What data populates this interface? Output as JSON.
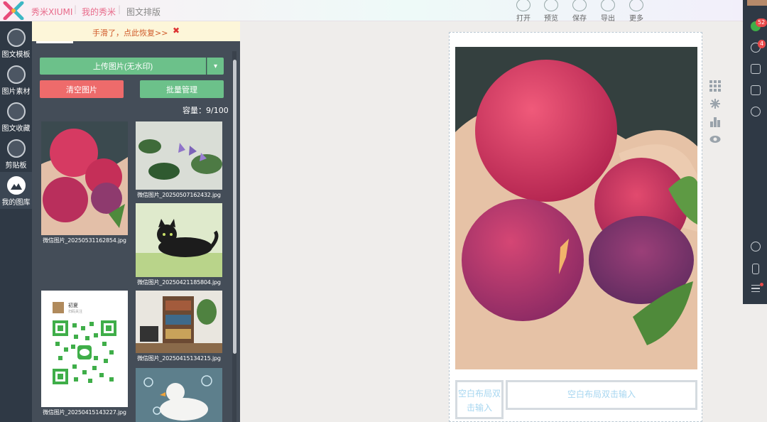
{
  "header": {
    "brand": "秀米XIUMI",
    "nav": [
      "我的秀米",
      "图文排版"
    ],
    "tools": [
      {
        "label": "打开",
        "icon": "open-icon"
      },
      {
        "label": "预览",
        "icon": "preview-icon"
      },
      {
        "label": "保存",
        "icon": "save-icon"
      },
      {
        "label": "导出",
        "icon": "export-icon"
      },
      {
        "label": "更多",
        "icon": "more-icon"
      }
    ]
  },
  "rail": {
    "items": [
      {
        "label": "图文模板",
        "icon": "template-icon"
      },
      {
        "label": "图片素材",
        "icon": "image-material-icon"
      },
      {
        "label": "图文收藏",
        "icon": "favorites-icon"
      },
      {
        "label": "剪贴板",
        "icon": "clipboard-icon"
      },
      {
        "label": "我的图库",
        "icon": "my-gallery-icon"
      }
    ]
  },
  "library": {
    "notice": "手滑了，点此恢复>>",
    "notice_close": "✖",
    "upload_label": "上传图片(无水印)",
    "upload_dropdown": "▾",
    "clear_label": "清空图片",
    "batch_label": "批量管理",
    "capacity": "容量：9/100",
    "images": [
      {
        "caption": "微信图片_20250531162854.jpg"
      },
      {
        "caption": "微信图片_20250507162432.jpg"
      },
      {
        "caption": "微信图片_20250421185804.jpg"
      },
      {
        "caption": "微信图片_20250415143227.jpg"
      },
      {
        "caption": "微信图片_20250415134215.jpg"
      },
      {
        "caption": ""
      }
    ],
    "qr_card": {
      "name": "初夏",
      "sub": "扫码关注"
    }
  },
  "canvas": {
    "blank_small": "空白布局双击输入",
    "blank_wide": "空白布局双击输入"
  },
  "right_panel": {
    "badge_messages": "52",
    "badge_users": "4"
  },
  "colors": {
    "accent_green": "#6cc18a",
    "danger_red": "#ee6b6b",
    "brand_pink": "#e86a8a",
    "dark_rail": "#2f3945"
  }
}
